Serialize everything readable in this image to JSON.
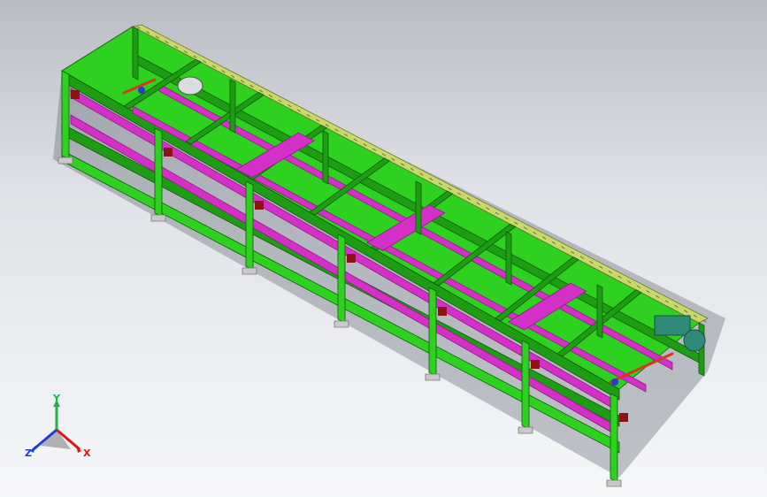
{
  "viewport": {
    "background_top": "#b9bcc3",
    "background_bottom": "#f6f7f9"
  },
  "model": {
    "frame_color": "#2ed11f",
    "frame_dark": "#1e9d14",
    "rail_color": "#d42fc6",
    "rail_dark": "#8c1b85",
    "top_rail_color": "#c9d86c",
    "motor_color": "#2f8a78",
    "bracket_color": "#8b1313",
    "foot_color": "#c9c9c9"
  },
  "triad": {
    "x_label": "X",
    "y_label": "Y",
    "z_label": "Z",
    "x_color": "#e11414",
    "y_color": "#21b34a",
    "z_color": "#1f3ed6"
  }
}
